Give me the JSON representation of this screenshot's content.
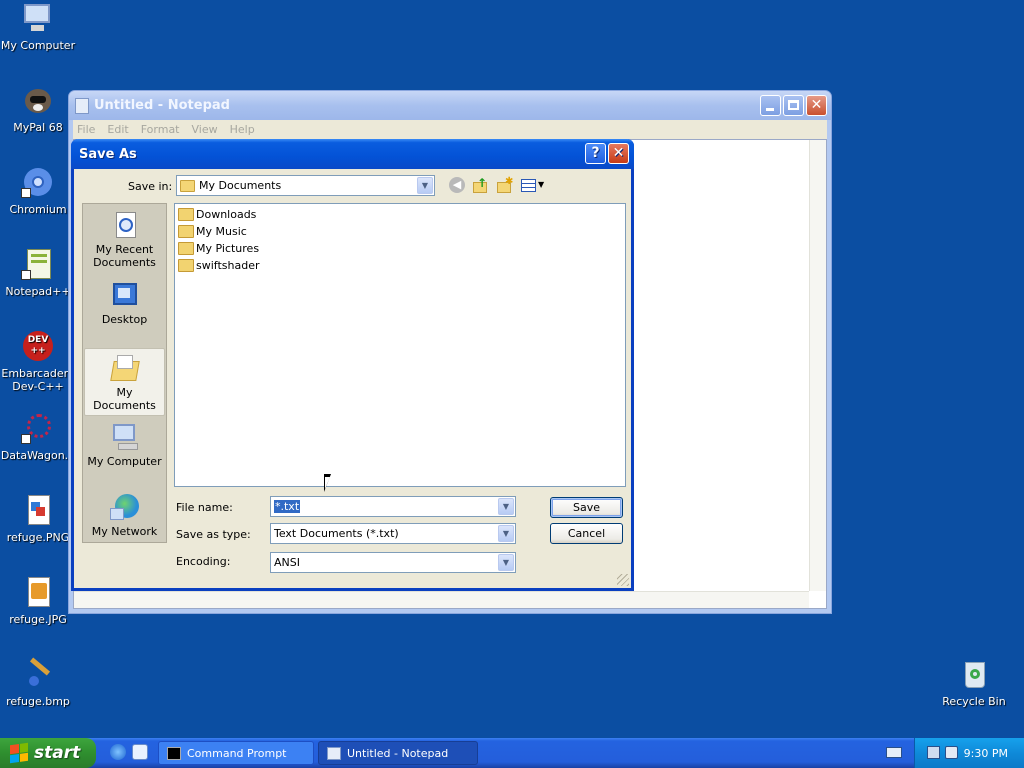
{
  "desktop": {
    "icons": [
      {
        "label": "My Computer"
      },
      {
        "label": "MyPal 68"
      },
      {
        "label": "Chromium"
      },
      {
        "label": "Notepad++"
      },
      {
        "label": "Embarcadero Dev-C++"
      },
      {
        "label": "DataWagon..."
      },
      {
        "label": "refuge.PNG"
      },
      {
        "label": "refuge.JPG"
      },
      {
        "label": "refuge.bmp"
      },
      {
        "label": "Recycle Bin"
      }
    ]
  },
  "notepad": {
    "title": "Untitled - Notepad",
    "menu": [
      "File",
      "Edit",
      "Format",
      "View",
      "Help"
    ]
  },
  "dialog": {
    "title": "Save As",
    "help_btn": "?",
    "save_in_label": "Save in:",
    "save_in_value": "My Documents",
    "places": [
      {
        "label": "My Recent Documents"
      },
      {
        "label": "Desktop"
      },
      {
        "label": "My Documents"
      },
      {
        "label": "My Computer"
      },
      {
        "label": "My Network"
      }
    ],
    "files": [
      "Downloads",
      "My Music",
      "My Pictures",
      "swiftshader"
    ],
    "file_name_label": "File name:",
    "file_name_value": "*.txt",
    "save_as_type_label": "Save as type:",
    "save_as_type_value": "Text Documents (*.txt)",
    "encoding_label": "Encoding:",
    "encoding_value": "ANSI",
    "save_btn": "Save",
    "cancel_btn": "Cancel"
  },
  "taskbar": {
    "start_label": "start",
    "tasks": [
      {
        "label": "Command Prompt"
      },
      {
        "label": "Untitled - Notepad"
      }
    ],
    "clock": "9:30 PM"
  },
  "colors": {
    "desktop_bg": "#0b4ea2",
    "dialog_title": "#0352d6",
    "selection": "#316ac5"
  }
}
